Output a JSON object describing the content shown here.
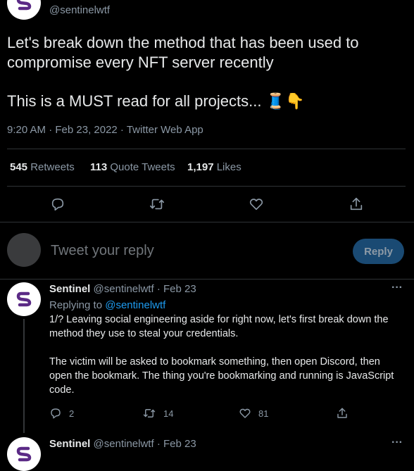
{
  "main_tweet": {
    "handle": "@sentinelwtf",
    "text_line1": "Let's break down the method that has been used to",
    "text_line2": "compromise every NFT server recently",
    "text_line3": "This is a MUST read for all projects... 🧵👇",
    "meta": "9:20 AM · Feb 23, 2022 · Twitter Web App",
    "retweets_count": "545",
    "retweets_label": "Retweets",
    "quotes_count": "113",
    "quotes_label": "Quote Tweets",
    "likes_count": "1,197",
    "likes_label": "Likes"
  },
  "reply_box": {
    "placeholder": "Tweet your reply",
    "button": "Reply"
  },
  "reply1": {
    "name": "Sentinel",
    "handle": "@sentinelwtf",
    "sep": "·",
    "date": "Feb 23",
    "replying_to_label": "Replying to",
    "replying_to_handle": "@sentinelwtf",
    "body_line1": "1/? Leaving social engineering aside for right now, let's first break down the",
    "body_line2": "method they use to steal your credentials.",
    "body_line3": "The victim will be asked to bookmark something, then open Discord, then",
    "body_line4": "open the bookmark. The thing you're bookmarking and running is JavaScript",
    "body_line5": "code.",
    "reply_count": "2",
    "retweet_count": "14",
    "like_count": "81",
    "more": "···"
  },
  "reply2": {
    "name": "Sentinel",
    "handle": "@sentinelwtf",
    "sep": "·",
    "date": "Feb 23",
    "more": "···"
  },
  "colors": {
    "background": "#000000",
    "text": "#e7e9ea",
    "muted": "#8b98a5",
    "accent": "#1d9bf0",
    "brand": "#5b2a86",
    "divider": "#2f3336"
  }
}
